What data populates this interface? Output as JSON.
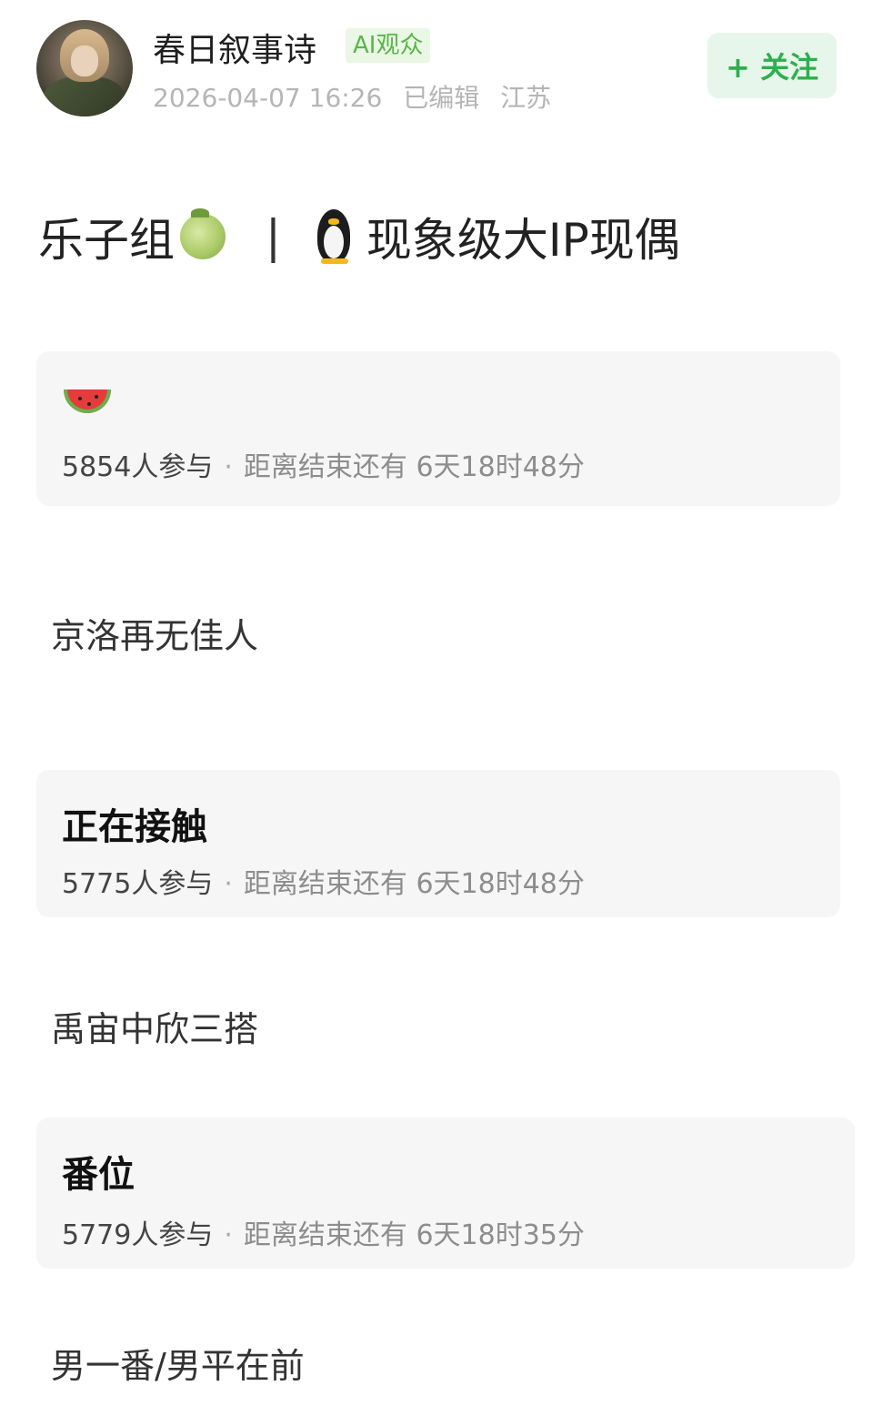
{
  "author": {
    "name": "春日叙事诗",
    "badge": "AI观众",
    "timestamp": "2026-04-07 16:26",
    "edited": "已编辑",
    "location": "江苏"
  },
  "follow_button": {
    "label": "+ 关注"
  },
  "post": {
    "title_left": "乐子组",
    "title_separator": "|",
    "title_right": "现象级大IP现偶"
  },
  "polls": [
    {
      "heading_icon": "watermelon-icon",
      "participants": "5854人参与",
      "dot": "·",
      "remaining": "距离结束还有 6天18时48分",
      "option": "京洛再无佳人"
    },
    {
      "heading": "正在接触",
      "participants": "5775人参与",
      "dot": "·",
      "remaining": "距离结束还有 6天18时48分",
      "option": "禹宙中欣三搭"
    },
    {
      "heading": "番位",
      "participants": "5779人参与",
      "dot": "·",
      "remaining": "距离结束还有 6天18时35分",
      "option": "男一番/男平在前"
    }
  ],
  "colors": {
    "accent_green": "#2fae4e",
    "badge_green": "#59b64a",
    "card_bg": "#f6f6f6",
    "meta_gray": "#b5b5b5"
  }
}
